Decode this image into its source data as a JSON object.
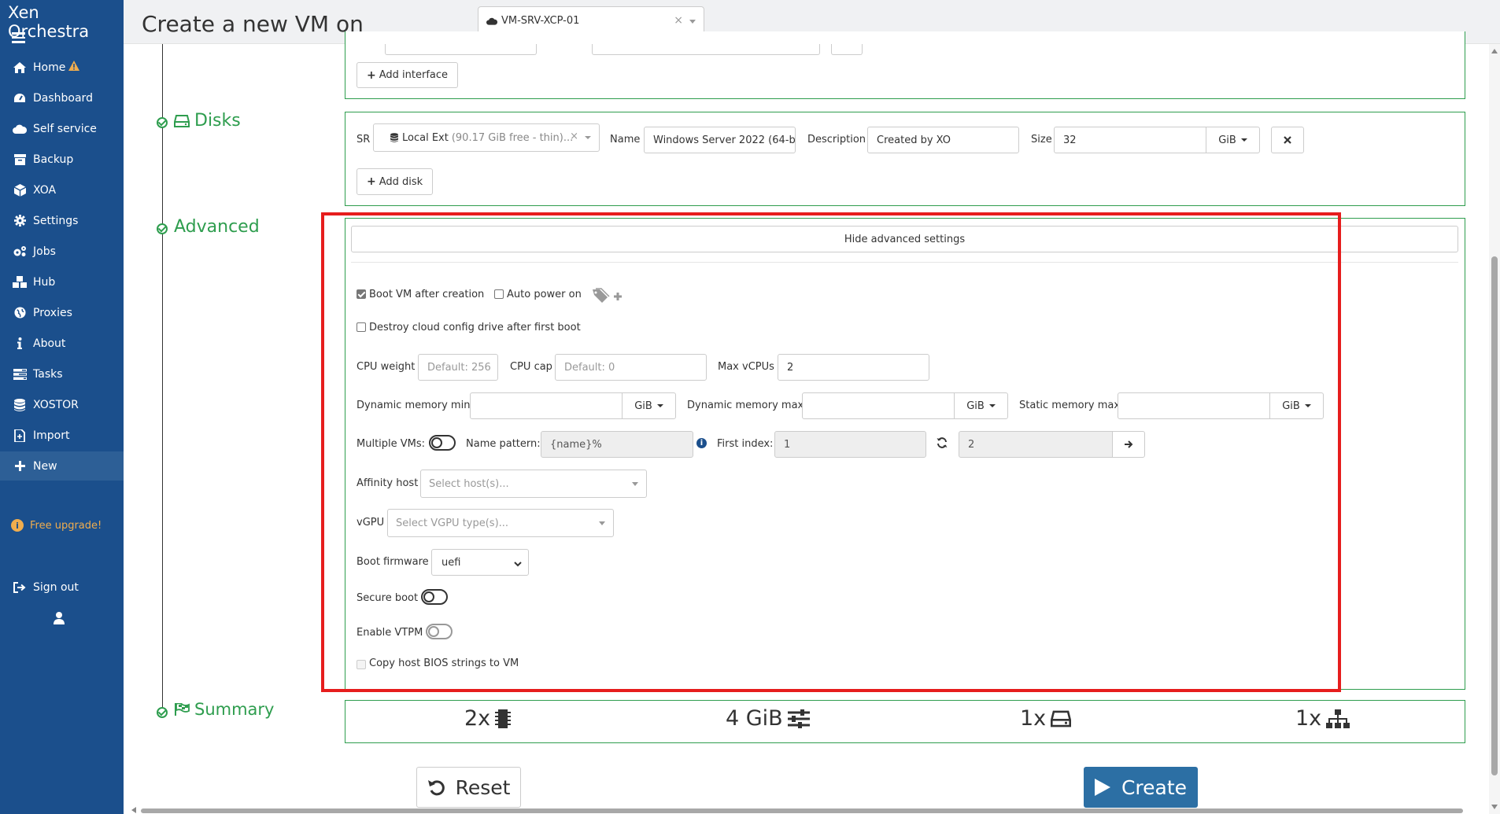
{
  "app": {
    "title": "Xen Orchestra"
  },
  "sidebar": {
    "items": [
      {
        "label": "Home",
        "icon": "home-icon"
      },
      {
        "label": "Dashboard",
        "icon": "dashboard-icon"
      },
      {
        "label": "Self service",
        "icon": "cloud-icon"
      },
      {
        "label": "Backup",
        "icon": "archive-icon"
      },
      {
        "label": "XOA",
        "icon": "cube-icon"
      },
      {
        "label": "Settings",
        "icon": "gear-icon"
      },
      {
        "label": "Jobs",
        "icon": "gears-icon"
      },
      {
        "label": "Hub",
        "icon": "cubes-icon"
      },
      {
        "label": "Proxies",
        "icon": "globe-icon"
      },
      {
        "label": "About",
        "icon": "info-icon"
      },
      {
        "label": "Tasks",
        "icon": "tasks-icon"
      },
      {
        "label": "XOSTOR",
        "icon": "database-icon"
      },
      {
        "label": "Import",
        "icon": "import-icon"
      },
      {
        "label": "New",
        "icon": "plus-icon"
      }
    ],
    "upgrade": "Free upgrade!",
    "signout": "Sign out"
  },
  "header": {
    "title": "Create a new VM on",
    "host": "VM-SRV-XCP-01"
  },
  "interfaces": {
    "add_button": "Add interface"
  },
  "disks": {
    "section": "Disks",
    "sr_label": "SR",
    "sr_name": "Local Ext",
    "sr_detail": "(90.17 GiB free - thin)...",
    "name_label": "Name",
    "name_value": "Windows Server 2022 (64-b",
    "description_label": "Description",
    "description_value": "Created by XO",
    "size_label": "Size",
    "size_value": "32",
    "size_unit": "GiB",
    "add_button": "Add disk"
  },
  "advanced": {
    "section": "Advanced",
    "toggle_button": "Hide advanced settings",
    "boot_after_creation": "Boot VM after creation",
    "auto_power_on": "Auto power on",
    "destroy_cloud_config": "Destroy cloud config drive after first boot",
    "cpu_weight_label": "CPU weight",
    "cpu_weight_placeholder": "Default: 256",
    "cpu_cap_label": "CPU cap",
    "cpu_cap_placeholder": "Default: 0",
    "max_vcpus_label": "Max vCPUs",
    "max_vcpus_value": "2",
    "dyn_mem_min_label": "Dynamic memory min",
    "dyn_mem_max_label": "Dynamic memory max",
    "static_mem_max_label": "Static memory max",
    "mem_unit": "GiB",
    "multiple_vms_label": "Multiple VMs:",
    "name_pattern_label": "Name pattern:",
    "name_pattern_value": "{name}%",
    "first_index_label": "First index:",
    "first_index_value": "1",
    "vm_count_value": "2",
    "affinity_label": "Affinity host",
    "affinity_placeholder": "Select host(s)...",
    "vgpu_label": "vGPU",
    "vgpu_placeholder": "Select VGPU type(s)...",
    "boot_firmware_label": "Boot firmware",
    "boot_firmware_value": "uefi",
    "secure_boot_label": "Secure boot",
    "vtpm_label": "Enable VTPM",
    "copy_bios_label": "Copy host BIOS strings to VM"
  },
  "summary": {
    "section": "Summary",
    "cpus": "2x",
    "memory": "4 GiB",
    "disks": "1x",
    "networks": "1x"
  },
  "actions": {
    "reset": "Reset",
    "create": "Create"
  },
  "colors": {
    "sidebar": "#1b4f8c",
    "accent_green": "#2e9d4e",
    "primary": "#2c6fa4",
    "warning": "#f0ad4e",
    "highlight": "#e61d1d"
  }
}
